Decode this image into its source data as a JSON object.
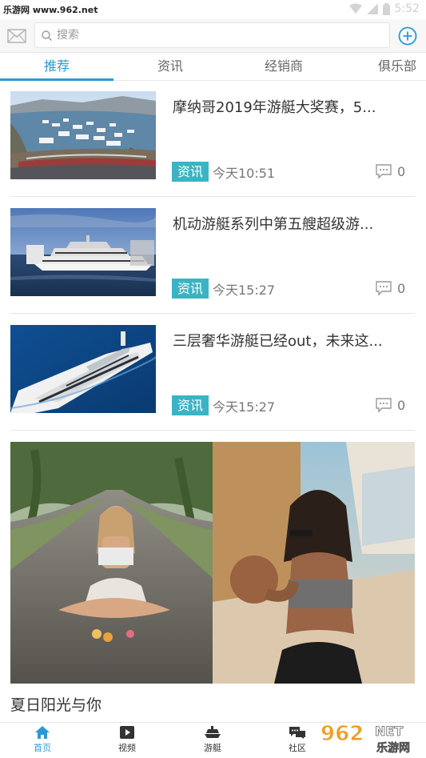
{
  "status_bar": {
    "watermark": "乐游网 www.962.net",
    "time": "5:52"
  },
  "search": {
    "placeholder": "搜索"
  },
  "tabs": [
    {
      "label": "推荐",
      "active": true
    },
    {
      "label": "资讯",
      "active": false
    },
    {
      "label": "经销商",
      "active": false
    },
    {
      "label": "俱乐部",
      "active": false
    }
  ],
  "news": [
    {
      "title": "摩纳哥2019年游艇大奖赛，5...",
      "tag": "资讯",
      "time": "今天10:51",
      "comments": "0"
    },
    {
      "title": "机动游艇系列中第五艘超级游...",
      "tag": "资讯",
      "time": "今天15:27",
      "comments": "0"
    },
    {
      "title": "三层奢华游艇已经out，未来这...",
      "tag": "资讯",
      "time": "今天15:27",
      "comments": "0"
    }
  ],
  "banner": {
    "caption": "夏日阳光与你"
  },
  "bottom_nav": [
    {
      "label": "首页",
      "icon": "home-icon",
      "active": true
    },
    {
      "label": "视频",
      "icon": "video-icon",
      "active": false
    },
    {
      "label": "游艇",
      "icon": "yacht-icon",
      "active": false
    },
    {
      "label": "社区",
      "icon": "community-icon",
      "active": false
    }
  ],
  "logo": {
    "text_main": "962",
    "text_net": "NET",
    "text_cn": "乐游网"
  },
  "colors": {
    "accent": "#2a9ad6",
    "tag": "#3ab4c4"
  }
}
